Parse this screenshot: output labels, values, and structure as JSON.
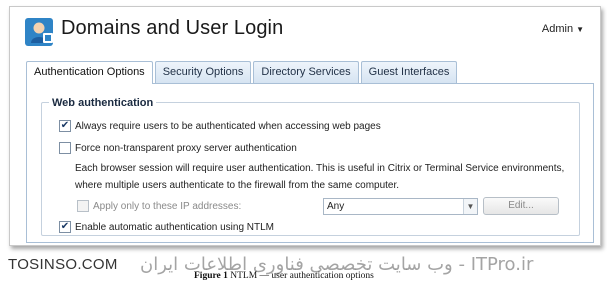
{
  "header": {
    "title": "Domains and User Login",
    "admin_label": "Admin"
  },
  "tabs": [
    {
      "label": "Authentication Options",
      "active": true
    },
    {
      "label": "Security Options",
      "active": false
    },
    {
      "label": "Directory Services",
      "active": false
    },
    {
      "label": "Guest Interfaces",
      "active": false
    }
  ],
  "web_auth": {
    "group_title": "Web authentication",
    "always_require": {
      "label": "Always require users to be authenticated when accessing web pages",
      "checked": true
    },
    "force_proxy": {
      "label": "Force non-transparent proxy server authentication",
      "checked": false
    },
    "description_line1": "Each browser session will require user authentication. This is useful in Citrix or Terminal Service environments,",
    "description_line2": "where multiple users authenticate to the firewall from the same computer.",
    "apply_ip": {
      "label": "Apply only to these IP addresses:",
      "checked": false,
      "enabled": false
    },
    "ip_select_value": "Any",
    "edit_button": "Edit...",
    "ntlm": {
      "label": "Enable automatic authentication using NTLM",
      "checked": true
    }
  },
  "caption": {
    "site": "TOSINSO.COM",
    "figure_label": "Figure 1",
    "figure_text": "NTLM — user authentication options",
    "watermark": "ITPro.ir - وب سایت تخصصی فناوری اطلاعات ایران"
  },
  "colors": {
    "tab_border": "#a9bfd6",
    "accent": "#1b3a66"
  }
}
